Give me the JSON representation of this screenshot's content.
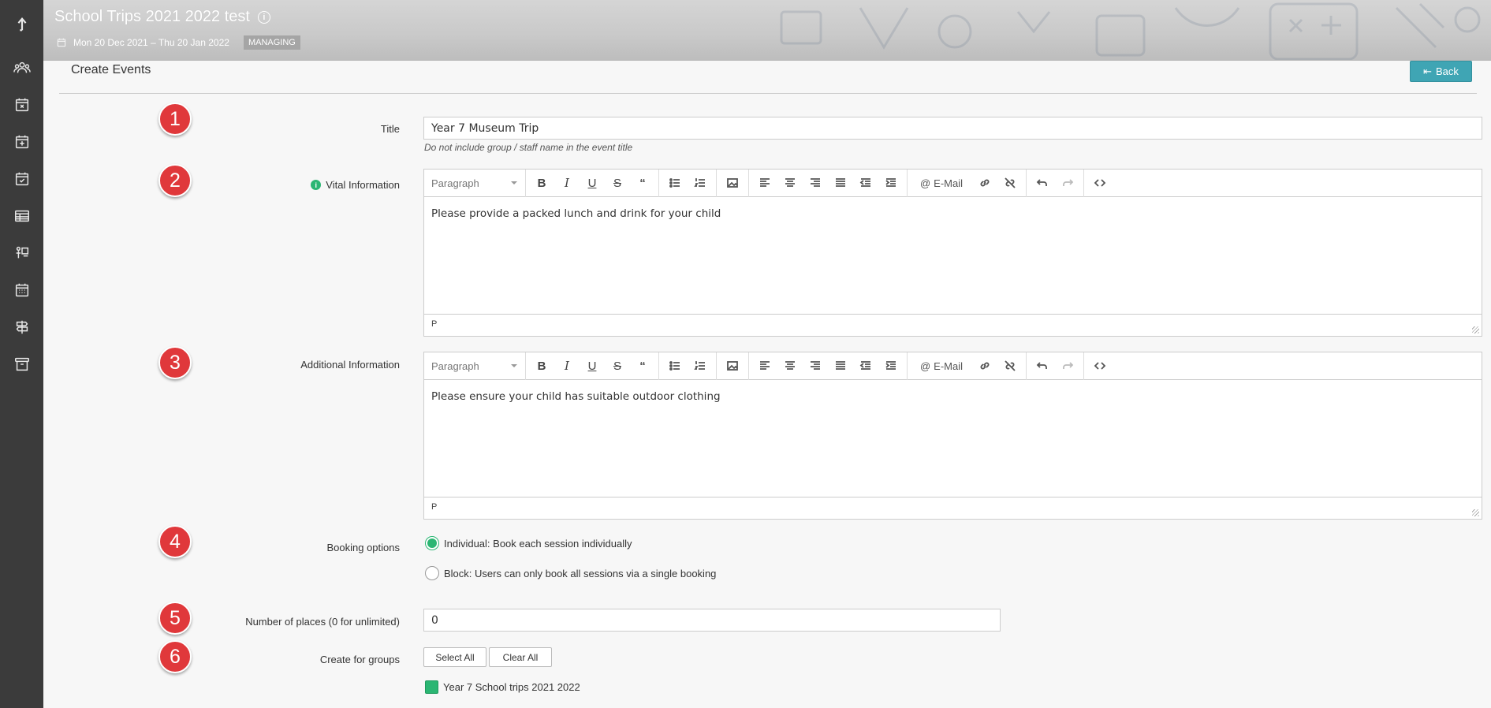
{
  "header": {
    "title": "School Trips 2021 2022 test",
    "dates": "Mon 20 Dec 2021 – Thu 20 Jan 2022",
    "status_badge": "MANAGING"
  },
  "sidebar": {
    "items": [
      {
        "icon": "arrow-up-icon"
      },
      {
        "icon": "users-icon"
      },
      {
        "icon": "calendar-x-icon"
      },
      {
        "icon": "calendar-plus-icon"
      },
      {
        "icon": "calendar-check-icon"
      },
      {
        "icon": "table-icon"
      },
      {
        "icon": "person-board-icon"
      },
      {
        "icon": "calendar-grid-icon"
      },
      {
        "icon": "signpost-icon"
      },
      {
        "icon": "archive-icon"
      }
    ]
  },
  "page": {
    "section_title": "Create Events",
    "back_label": "Back"
  },
  "steps": [
    "1",
    "2",
    "3",
    "4",
    "5",
    "6"
  ],
  "form": {
    "title_label": "Title",
    "title_value": "Year 7 Museum Trip",
    "title_help": "Do not include group / staff name in the event title",
    "vital_label": "Vital Information",
    "vital_value": "Please provide a packed lunch and drink for your child",
    "additional_label": "Additional Information",
    "additional_value": "Please ensure your child has suitable outdoor clothing",
    "editor_format": "Paragraph",
    "editor_email": "E-Mail",
    "editor_path": "P",
    "booking_label": "Booking options",
    "booking_options": [
      {
        "label": "Individual: Book each session individually",
        "checked": true
      },
      {
        "label": "Block: Users can only book all sessions via a single booking",
        "checked": false
      }
    ],
    "places_label": "Number of places (0 for unlimited)",
    "places_value": "0",
    "groups_label": "Create for groups",
    "select_all": "Select All",
    "clear_all": "Clear All",
    "groups": [
      {
        "label": "Year 7 School trips 2021 2022",
        "checked": true
      }
    ]
  },
  "colors": {
    "accent_button": "#3fa5b4",
    "step_marker": "#e0383b",
    "success_green": "#2bb673",
    "sidebar": "#3b3b3b"
  }
}
